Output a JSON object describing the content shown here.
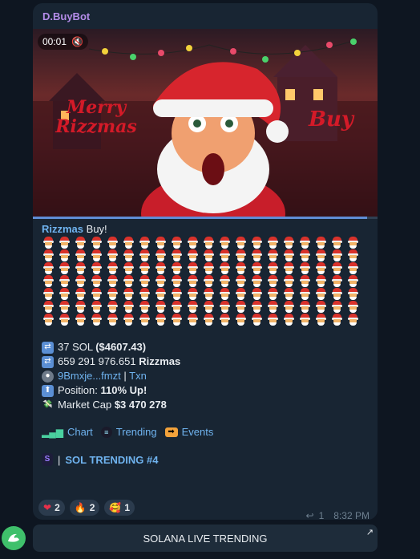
{
  "message": {
    "sender": "D.BuyBot",
    "video": {
      "time": "00:01",
      "progress": 0.97,
      "banner_left": "Merry Rizzmas",
      "banner_right": "Buy"
    },
    "headline": {
      "token": "Rizzmas",
      "text": " Buy!"
    },
    "emoji_count": 140,
    "stats": {
      "sol_amount": "37 SOL ",
      "sol_usd": "($4607.43)",
      "token_amount": "659 291 976.651 ",
      "token_name": "Rizzmas",
      "wallet": "9Bmxje...fmzt",
      "separator": " | ",
      "txn": "Txn",
      "position_label": "Position: ",
      "position_value": "110% Up!",
      "mcap_label": "Market Cap ",
      "mcap_value": "$3 470 278"
    },
    "links": [
      "Chart",
      "Trending",
      "Events"
    ],
    "trending": {
      "separator": " | ",
      "label": "SOL TRENDING #4"
    },
    "reactions": [
      {
        "icon": "heart-icon",
        "count": "2"
      },
      {
        "icon": "fire-icon",
        "count": "2"
      },
      {
        "icon": "heart-eyes-face-icon",
        "count": "1"
      }
    ],
    "replies": "1",
    "time": "8:32 PM"
  },
  "bottom_button": {
    "label": "SOLANA LIVE TRENDING"
  },
  "colors": {
    "background": "#0e1621",
    "bubble": "#182533",
    "link": "#6fb3ef",
    "sender": "#b48ce8"
  }
}
